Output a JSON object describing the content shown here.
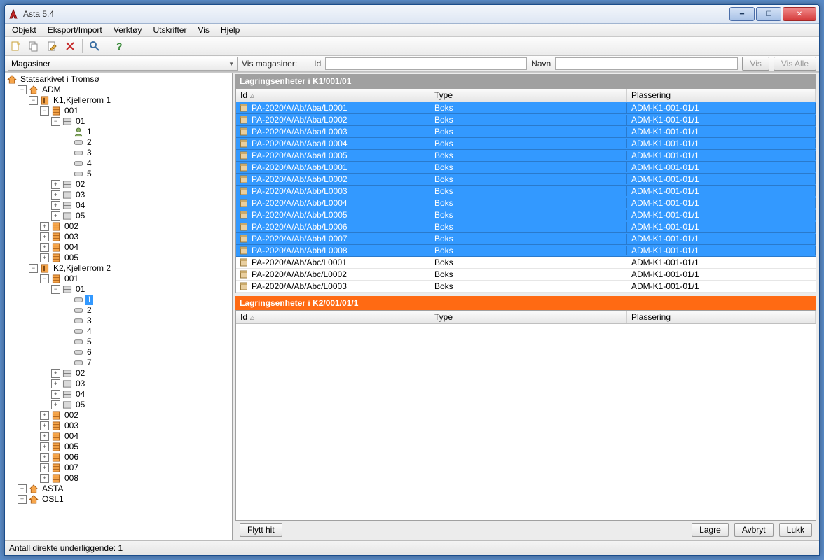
{
  "window": {
    "title": "Asta 5.4"
  },
  "menu": {
    "items": [
      "Objekt",
      "Eksport/Import",
      "Verktøy",
      "Utskrifter",
      "Vis",
      "Hjelp"
    ]
  },
  "toolbar": {
    "icons": [
      "new-doc-icon",
      "copy-icon",
      "edit-icon",
      "delete-icon",
      "search-icon",
      "help-icon"
    ]
  },
  "filter": {
    "combo_value": "Magasiner",
    "vis_label": "Vis magasiner:",
    "id_label": "Id",
    "navn_label": "Navn",
    "vis_btn": "Vis",
    "vis_alle_btn": "Vis Alle"
  },
  "tree": {
    "root": {
      "label": "Statsarkivet i Tromsø",
      "icon": "home"
    },
    "nodes": [
      {
        "d": 1,
        "t": "-",
        "i": "home",
        "l": "ADM"
      },
      {
        "d": 2,
        "t": "-",
        "i": "door",
        "l": "K1,Kjellerrom 1"
      },
      {
        "d": 3,
        "t": "-",
        "i": "rack",
        "l": "001"
      },
      {
        "d": 4,
        "t": "-",
        "i": "shelf",
        "l": "01"
      },
      {
        "d": 5,
        "t": " ",
        "i": "person",
        "l": "1"
      },
      {
        "d": 5,
        "t": " ",
        "i": "slot",
        "l": "2"
      },
      {
        "d": 5,
        "t": " ",
        "i": "slot",
        "l": "3"
      },
      {
        "d": 5,
        "t": " ",
        "i": "slot",
        "l": "4"
      },
      {
        "d": 5,
        "t": " ",
        "i": "slot",
        "l": "5"
      },
      {
        "d": 4,
        "t": "+",
        "i": "shelf",
        "l": "02"
      },
      {
        "d": 4,
        "t": "+",
        "i": "shelf",
        "l": "03"
      },
      {
        "d": 4,
        "t": "+",
        "i": "shelf",
        "l": "04"
      },
      {
        "d": 4,
        "t": "+",
        "i": "shelf",
        "l": "05"
      },
      {
        "d": 3,
        "t": "+",
        "i": "rack",
        "l": "002"
      },
      {
        "d": 3,
        "t": "+",
        "i": "rack",
        "l": "003"
      },
      {
        "d": 3,
        "t": "+",
        "i": "rack",
        "l": "004"
      },
      {
        "d": 3,
        "t": "+",
        "i": "rack",
        "l": "005"
      },
      {
        "d": 2,
        "t": "-",
        "i": "door",
        "l": "K2,Kjellerrom 2"
      },
      {
        "d": 3,
        "t": "-",
        "i": "rack",
        "l": "001"
      },
      {
        "d": 4,
        "t": "-",
        "i": "shelf",
        "l": "01"
      },
      {
        "d": 5,
        "t": " ",
        "i": "slot",
        "l": "1",
        "sel": true
      },
      {
        "d": 5,
        "t": " ",
        "i": "slot",
        "l": "2"
      },
      {
        "d": 5,
        "t": " ",
        "i": "slot",
        "l": "3"
      },
      {
        "d": 5,
        "t": " ",
        "i": "slot",
        "l": "4"
      },
      {
        "d": 5,
        "t": " ",
        "i": "slot",
        "l": "5"
      },
      {
        "d": 5,
        "t": " ",
        "i": "slot",
        "l": "6"
      },
      {
        "d": 5,
        "t": " ",
        "i": "slot",
        "l": "7"
      },
      {
        "d": 4,
        "t": "+",
        "i": "shelf",
        "l": "02"
      },
      {
        "d": 4,
        "t": "+",
        "i": "shelf",
        "l": "03"
      },
      {
        "d": 4,
        "t": "+",
        "i": "shelf",
        "l": "04"
      },
      {
        "d": 4,
        "t": "+",
        "i": "shelf",
        "l": "05"
      },
      {
        "d": 3,
        "t": "+",
        "i": "rack",
        "l": "002"
      },
      {
        "d": 3,
        "t": "+",
        "i": "rack",
        "l": "003"
      },
      {
        "d": 3,
        "t": "+",
        "i": "rack",
        "l": "004"
      },
      {
        "d": 3,
        "t": "+",
        "i": "rack",
        "l": "005"
      },
      {
        "d": 3,
        "t": "+",
        "i": "rack",
        "l": "006"
      },
      {
        "d": 3,
        "t": "+",
        "i": "rack",
        "l": "007"
      },
      {
        "d": 3,
        "t": "+",
        "i": "rack",
        "l": "008"
      },
      {
        "d": 1,
        "t": "+",
        "i": "home",
        "l": "ASTA"
      },
      {
        "d": 1,
        "t": "+",
        "i": "home",
        "l": "OSL1"
      }
    ]
  },
  "top_panel": {
    "title": "Lagringsenheter i K1/001/01",
    "cols": [
      "Id",
      "Type",
      "Plassering"
    ],
    "rows": [
      {
        "id": "PA-2020/A/Ab/Aba/L0001",
        "type": "Boks",
        "pl": "ADM-K1-001-01/1",
        "sel": true
      },
      {
        "id": "PA-2020/A/Ab/Aba/L0002",
        "type": "Boks",
        "pl": "ADM-K1-001-01/1",
        "sel": true
      },
      {
        "id": "PA-2020/A/Ab/Aba/L0003",
        "type": "Boks",
        "pl": "ADM-K1-001-01/1",
        "sel": true
      },
      {
        "id": "PA-2020/A/Ab/Aba/L0004",
        "type": "Boks",
        "pl": "ADM-K1-001-01/1",
        "sel": true
      },
      {
        "id": "PA-2020/A/Ab/Aba/L0005",
        "type": "Boks",
        "pl": "ADM-K1-001-01/1",
        "sel": true
      },
      {
        "id": "PA-2020/A/Ab/Abb/L0001",
        "type": "Boks",
        "pl": "ADM-K1-001-01/1",
        "sel": true
      },
      {
        "id": "PA-2020/A/Ab/Abb/L0002",
        "type": "Boks",
        "pl": "ADM-K1-001-01/1",
        "sel": true
      },
      {
        "id": "PA-2020/A/Ab/Abb/L0003",
        "type": "Boks",
        "pl": "ADM-K1-001-01/1",
        "sel": true
      },
      {
        "id": "PA-2020/A/Ab/Abb/L0004",
        "type": "Boks",
        "pl": "ADM-K1-001-01/1",
        "sel": true
      },
      {
        "id": "PA-2020/A/Ab/Abb/L0005",
        "type": "Boks",
        "pl": "ADM-K1-001-01/1",
        "sel": true
      },
      {
        "id": "PA-2020/A/Ab/Abb/L0006",
        "type": "Boks",
        "pl": "ADM-K1-001-01/1",
        "sel": true
      },
      {
        "id": "PA-2020/A/Ab/Abb/L0007",
        "type": "Boks",
        "pl": "ADM-K1-001-01/1",
        "sel": true
      },
      {
        "id": "PA-2020/A/Ab/Abb/L0008",
        "type": "Boks",
        "pl": "ADM-K1-001-01/1",
        "sel": true
      },
      {
        "id": "PA-2020/A/Ab/Abc/L0001",
        "type": "Boks",
        "pl": "ADM-K1-001-01/1",
        "sel": false
      },
      {
        "id": "PA-2020/A/Ab/Abc/L0002",
        "type": "Boks",
        "pl": "ADM-K1-001-01/1",
        "sel": false
      },
      {
        "id": "PA-2020/A/Ab/Abc/L0003",
        "type": "Boks",
        "pl": "ADM-K1-001-01/1",
        "sel": false
      }
    ]
  },
  "bottom_panel": {
    "title": "Lagringsenheter i K2/001/01/1",
    "cols": [
      "Id",
      "Type",
      "Plassering"
    ],
    "rows": []
  },
  "buttons": {
    "flytt": "Flytt hit",
    "lagre": "Lagre",
    "avbryt": "Avbryt",
    "lukk": "Lukk"
  },
  "status": {
    "text": "Antall direkte underliggende: 1"
  }
}
